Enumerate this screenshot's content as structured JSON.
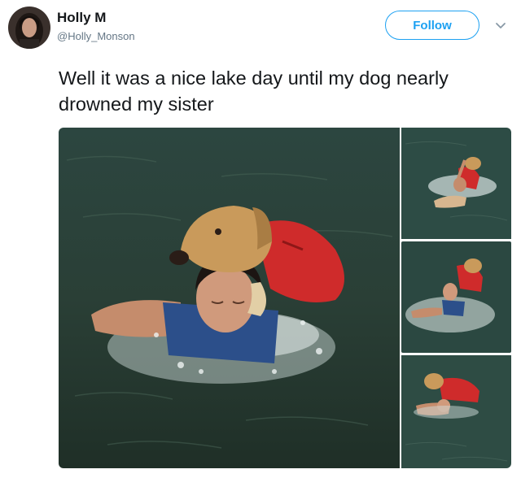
{
  "tweet": {
    "display_name": "Holly M",
    "handle": "@Holly_Monson",
    "follow_label": "Follow",
    "text": "Well it was a nice lake day until my dog nearly drowned my sister"
  },
  "icons": {
    "caret": "chevron-down-icon",
    "avatar": "avatar"
  },
  "colors": {
    "accent": "#1da1f2",
    "name": "#14171a",
    "handle": "#657786",
    "water": "#2f4a3a",
    "vest_red": "#d42a2a",
    "dog_gold": "#c89a5a"
  }
}
